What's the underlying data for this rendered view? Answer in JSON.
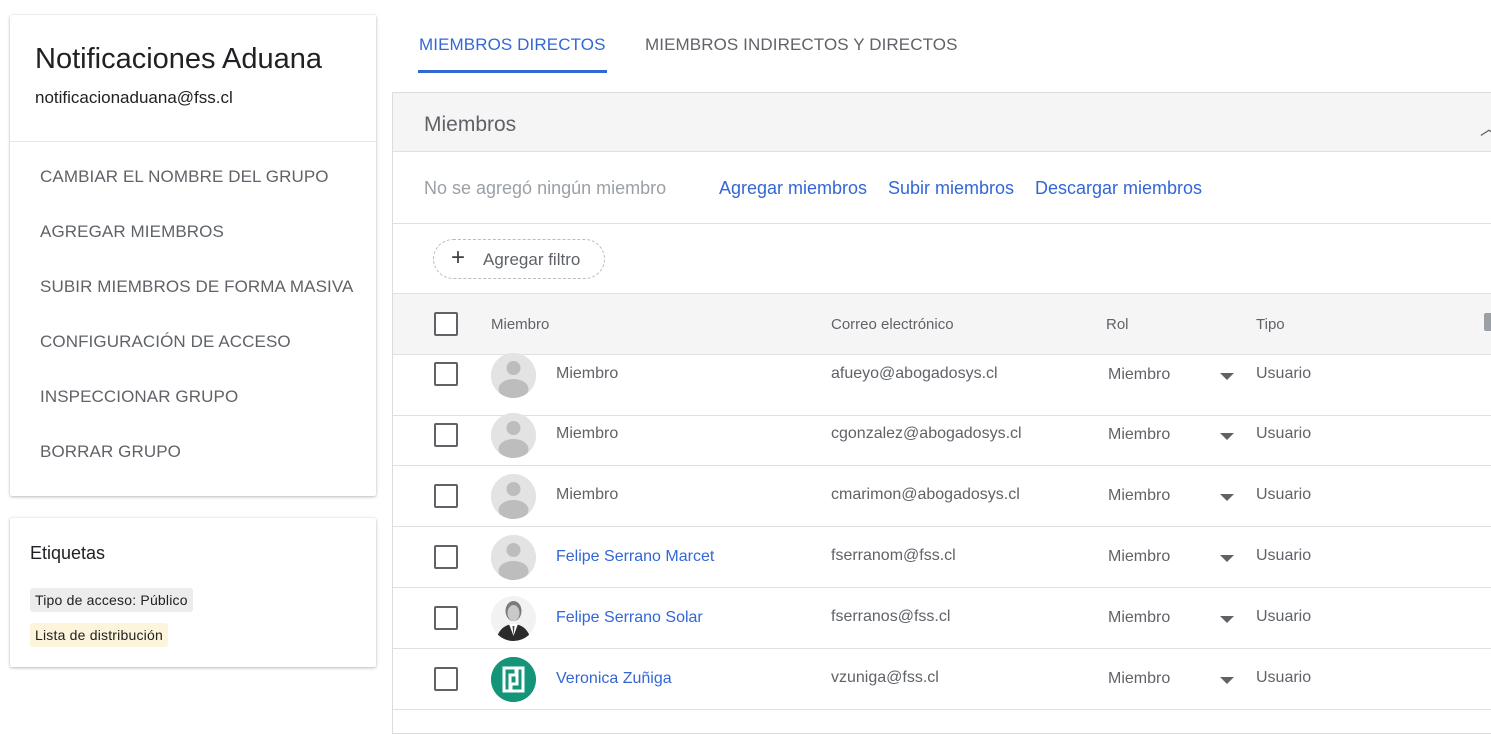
{
  "group": {
    "name": "Notificaciones Aduana",
    "email": "notificacionaduana@fss.cl",
    "menu": [
      "CAMBIAR EL NOMBRE DEL GRUPO",
      "AGREGAR MIEMBROS",
      "SUBIR MIEMBROS DE FORMA MASIVA",
      "CONFIGURACIÓN DE ACCESO",
      "INSPECCIONAR GRUPO",
      "BORRAR GRUPO"
    ]
  },
  "labels": {
    "title": "Etiquetas",
    "chips": [
      "Tipo de acceso: Público",
      "Lista de distribución"
    ]
  },
  "tabs": {
    "direct": "MIEMBROS DIRECTOS",
    "indirect": "MIEMBROS INDIRECTOS Y DIRECTOS",
    "active": "direct"
  },
  "members_panel": {
    "title": "Miembros",
    "empty_text": "No se agregó ningún miembro",
    "actions": {
      "add": "Agregar miembros",
      "upload": "Subir miembros",
      "download": "Descargar miembros"
    },
    "filter_label": "Agregar filtro"
  },
  "table": {
    "headers": {
      "member": "Miembro",
      "email": "Correo electrónico",
      "role": "Rol",
      "type": "Tipo"
    },
    "rows": [
      {
        "name": "Miembro",
        "email": "afueyo@abogadosys.cl",
        "role": "Miembro",
        "type": "Usuario",
        "avatar": "default-avatar"
      },
      {
        "name": "Miembro",
        "email": "cgonzalez@abogadosys.cl",
        "role": "Miembro",
        "type": "Usuario",
        "avatar": "default-avatar"
      },
      {
        "name": "Miembro",
        "email": "cmarimon@abogadosys.cl",
        "role": "Miembro",
        "type": "Usuario",
        "avatar": "default-avatar"
      },
      {
        "name": "Felipe Serrano Marcet",
        "email": "fserranom@fss.cl",
        "role": "Miembro",
        "type": "Usuario",
        "avatar": "default-avatar"
      },
      {
        "name": "Felipe Serrano Solar",
        "email": "fserranos@fss.cl",
        "role": "Miembro",
        "type": "Usuario",
        "avatar": "photo-avatar"
      },
      {
        "name": "Veronica Zuñiga",
        "email": "vzuniga@fss.cl",
        "role": "Miembro",
        "type": "Usuario",
        "avatar": "logo-avatar"
      }
    ]
  },
  "colors": {
    "accent": "#3367d6",
    "header_bg": "#f5f5f5",
    "chip_gray": "#ececec",
    "chip_yellow": "#fdf4dc",
    "logo_green": "#14957a"
  }
}
